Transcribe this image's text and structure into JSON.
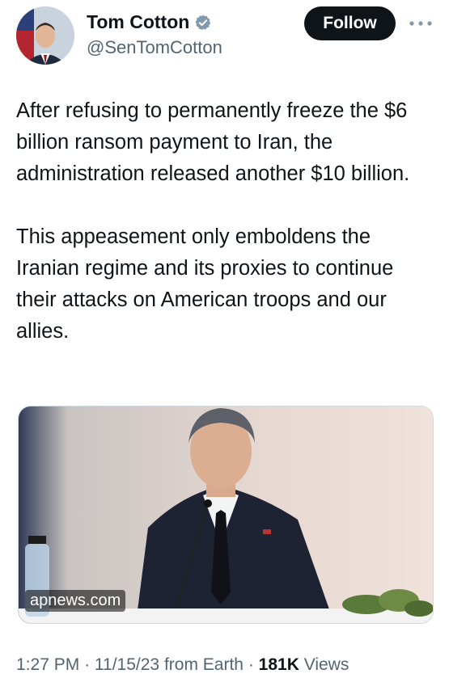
{
  "author": {
    "name": "Tom Cotton",
    "handle": "@SenTomCotton",
    "verified_icon": "verified-badge-icon"
  },
  "actions": {
    "follow_label": "Follow",
    "more_icon": "more-dots-icon"
  },
  "tweet": {
    "paragraphs": [
      "After refusing to permanently freeze the $6 billion ransom payment to Iran, the administration released another $10 billion.",
      "This appeasement only emboldens the Iranian regime and its proxies to continue their attacks on American troops and our allies."
    ]
  },
  "media": {
    "domain": "apnews.com"
  },
  "meta": {
    "time": "1:27 PM",
    "date": "11/15/23",
    "source": "from Earth",
    "separator": "·",
    "views_count": "181K",
    "views_label": "Views"
  },
  "colors": {
    "text_primary": "#0f1419",
    "text_secondary": "#536471",
    "follow_bg": "#0f1419",
    "verified": "#829aab"
  }
}
